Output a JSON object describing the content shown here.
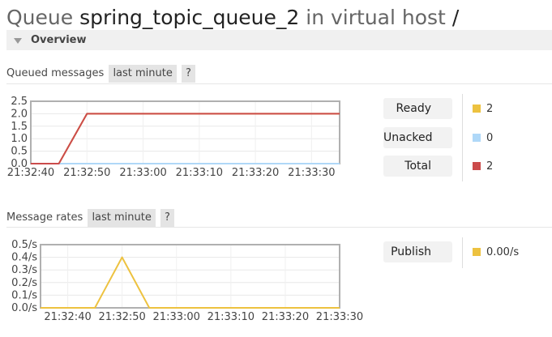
{
  "page": {
    "title_prefix": "Queue",
    "queue_name": "spring_topic_queue_2",
    "title_middle": "in virtual host",
    "vhost": "/"
  },
  "overview": {
    "label": "Overview"
  },
  "queued": {
    "label": "Queued messages",
    "range": "last minute",
    "help": "?",
    "legend": [
      {
        "label": "Ready",
        "value": "2",
        "color": "#edc240"
      },
      {
        "label": "Unacked",
        "value": "0",
        "color": "#afd8f8"
      },
      {
        "label": "Total",
        "value": "2",
        "color": "#cb4b4b"
      }
    ]
  },
  "rates": {
    "label": "Message rates",
    "range": "last minute",
    "help": "?",
    "legend": [
      {
        "label": "Publish",
        "value": "0.00/s",
        "color": "#edc240"
      }
    ]
  },
  "chart_data": [
    {
      "type": "line",
      "x": [
        "21:32:40",
        "21:32:45",
        "21:32:50",
        "21:32:55",
        "21:33:00",
        "21:33:05",
        "21:33:10",
        "21:33:15",
        "21:33:20",
        "21:33:25",
        "21:33:30",
        "21:33:35"
      ],
      "xticks": [
        "21:32:40",
        "21:32:50",
        "21:33:00",
        "21:33:10",
        "21:33:20",
        "21:33:30"
      ],
      "yticks": [
        "0.0",
        "0.5",
        "1.0",
        "1.5",
        "2.0",
        "2.5"
      ],
      "ylim": [
        0,
        2.5
      ],
      "grid": true,
      "series": [
        {
          "name": "Ready",
          "color": "#edc240",
          "values": [
            0,
            0,
            2,
            2,
            2,
            2,
            2,
            2,
            2,
            2,
            2,
            2
          ]
        },
        {
          "name": "Unacked",
          "color": "#afd8f8",
          "values": [
            0,
            0,
            0,
            0,
            0,
            0,
            0,
            0,
            0,
            0,
            0,
            0
          ]
        },
        {
          "name": "Total",
          "color": "#cb4b4b",
          "values": [
            0,
            0,
            2,
            2,
            2,
            2,
            2,
            2,
            2,
            2,
            2,
            2
          ]
        }
      ]
    },
    {
      "type": "line",
      "x": [
        "21:32:35",
        "21:32:40",
        "21:32:45",
        "21:32:50",
        "21:32:55",
        "21:33:00",
        "21:33:05",
        "21:33:10",
        "21:33:15",
        "21:33:20",
        "21:33:25",
        "21:33:30"
      ],
      "xticks": [
        "21:32:40",
        "21:32:50",
        "21:33:00",
        "21:33:10",
        "21:33:20",
        "21:33:30"
      ],
      "yticks": [
        "0.0/s",
        "0.1/s",
        "0.2/s",
        "0.3/s",
        "0.4/s",
        "0.5/s"
      ],
      "ylim": [
        0,
        0.5
      ],
      "grid": true,
      "series": [
        {
          "name": "Publish",
          "color": "#edc240",
          "values": [
            0,
            0,
            0,
            0.4,
            0,
            0,
            0,
            0,
            0,
            0,
            0,
            0
          ]
        }
      ]
    }
  ]
}
